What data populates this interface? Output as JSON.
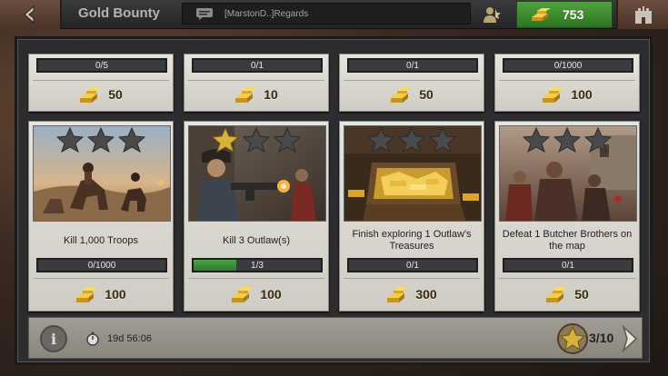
{
  "header": {
    "title": "Gold Bounty",
    "chat_message": "[MarstonD..]Regards",
    "gold_amount": "753"
  },
  "top_row": [
    {
      "progress": "0/5",
      "reward": "50"
    },
    {
      "progress": "0/1",
      "reward": "10"
    },
    {
      "progress": "0/1",
      "reward": "50"
    },
    {
      "progress": "0/1000",
      "reward": "100"
    }
  ],
  "bounties": [
    {
      "description": "Kill 1,000 Troops",
      "progress": "0/1000",
      "progress_fraction": 0,
      "stars_earned": 0,
      "stars_total": 3,
      "reward": "100"
    },
    {
      "description": "Kill 3 Outlaw(s)",
      "progress": "1/3",
      "progress_fraction": 0.333,
      "stars_earned": 1,
      "stars_total": 3,
      "reward": "100"
    },
    {
      "description": "Finish exploring 1 Outlaw's Treasures",
      "progress": "0/1",
      "progress_fraction": 0,
      "stars_earned": 0,
      "stars_total": 3,
      "reward": "300"
    },
    {
      "description": "Defeat 1 Butcher Brothers on the map",
      "progress": "0/1",
      "progress_fraction": 0,
      "stars_earned": 0,
      "stars_total": 3,
      "reward": "50"
    }
  ],
  "footer": {
    "timer": "19d 56:06",
    "stars_progress": "3/10"
  },
  "colors": {
    "gold_button": "#3f8f33",
    "progress_fill": "#3e963d",
    "star_earned": "#d8b23a",
    "star_empty": "#4a4a4a"
  }
}
